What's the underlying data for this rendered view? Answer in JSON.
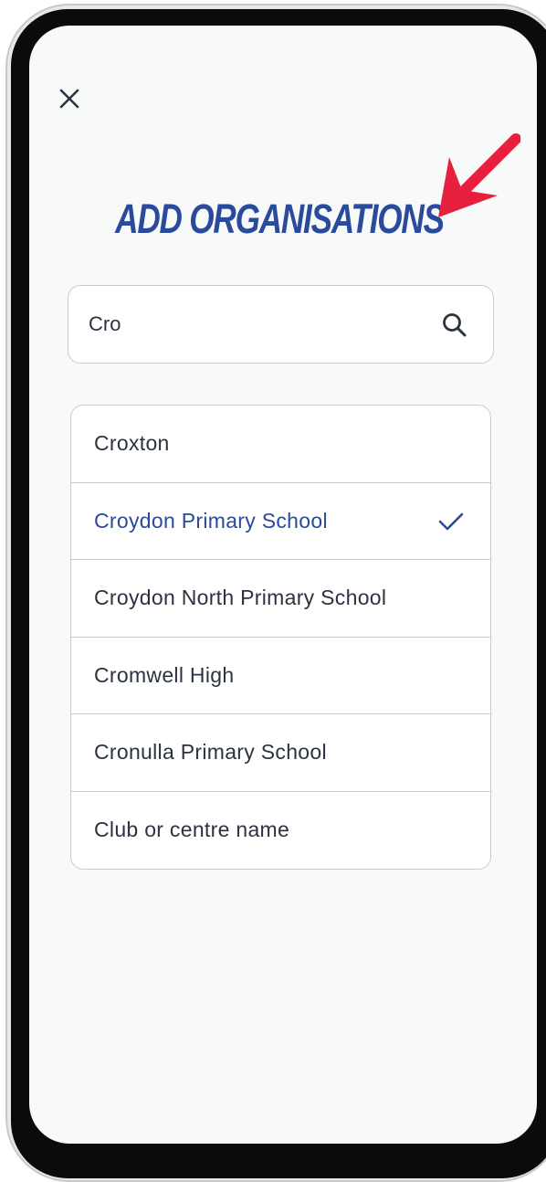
{
  "screen": {
    "title": "ADD ORGANISATIONS",
    "close_icon": "close-icon"
  },
  "search": {
    "value": "Cro",
    "icon": "search-icon"
  },
  "results": {
    "items": [
      {
        "label": "Croxton",
        "selected": false
      },
      {
        "label": "Croydon Primary School",
        "selected": true
      },
      {
        "label": "Croydon North Primary School",
        "selected": false
      },
      {
        "label": "Cromwell High",
        "selected": false
      },
      {
        "label": "Cronulla Primary School",
        "selected": false
      },
      {
        "label": "Club or centre name",
        "selected": false
      }
    ],
    "selected_icon": "check-icon"
  },
  "colors": {
    "accent": "#2a4b9b",
    "text": "#2c3340",
    "border": "#c8ccd2",
    "annotation_arrow": "#e8203f",
    "screen_bg": "#f8f9f9"
  }
}
